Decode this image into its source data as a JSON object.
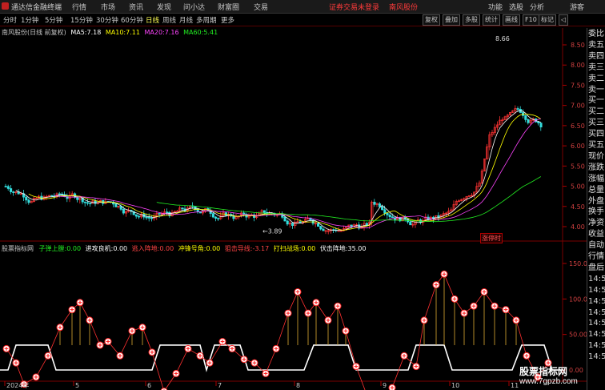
{
  "app": {
    "title": "通达信金融终端",
    "alert": "证券交易未登录",
    "stock_tab": "南风股份"
  },
  "menu": [
    "行情",
    "市场",
    "资讯",
    "发现",
    "问小达",
    "财富圈",
    "交易"
  ],
  "right_menu": [
    "功能",
    "选股",
    "分析",
    "游客"
  ],
  "periods": [
    "分时",
    "1分钟",
    "5分钟",
    "15分钟",
    "30分钟",
    "60分钟",
    "日线",
    "周线",
    "月线",
    "多周期",
    "更多"
  ],
  "active_period": "日线",
  "toolbar_buttons": [
    "复权",
    "叠加",
    "多股",
    "统计",
    "画线",
    "F10",
    "标记",
    "◁"
  ],
  "main_chart": {
    "title": "南风股份(日线 前复权)",
    "ma": [
      {
        "label": "MA5:",
        "value": "7.18",
        "color": "#ffffff"
      },
      {
        "label": "MA10:",
        "value": "7.11",
        "color": "#ffff00"
      },
      {
        "label": "MA20:",
        "value": "7.16",
        "color": "#ff44ff"
      },
      {
        "label": "MA60:",
        "value": "5.41",
        "color": "#22ee22"
      }
    ],
    "high_label": "8.66",
    "low_label": "3.89",
    "y_ticks": [
      "8.50",
      "8.00",
      "7.50",
      "7.00",
      "6.50",
      "6.00",
      "5.50",
      "5.00",
      "4.50",
      "4.00"
    ],
    "tag": "涨停时"
  },
  "indicator": {
    "title": "股票指标网",
    "items": [
      {
        "label": "子弹上膛:",
        "value": "0.00",
        "color": "#22ee22"
      },
      {
        "label": "进攻良机:",
        "value": "0.00",
        "color": "#ffffff"
      },
      {
        "label": "逃入阵地:",
        "value": "0.00",
        "color": "#ff4444"
      },
      {
        "label": "冲锋号角:",
        "value": "0.00",
        "color": "#ffff00"
      },
      {
        "label": "狙击导线:",
        "value": "-3.17",
        "color": "#ff4444"
      },
      {
        "label": "打扫战场:",
        "value": "0.00",
        "color": "#ffff00"
      },
      {
        "label": "伏击阵地:",
        "value": "35.00",
        "color": "#ffffff"
      }
    ],
    "y_ticks": [
      "150.00",
      "100.00",
      "50.00",
      "0.00"
    ]
  },
  "right_panel": [
    "委比",
    "卖五",
    "卖四",
    "卖三",
    "卖二",
    "卖一",
    "买一",
    "买二",
    "买三",
    "买四",
    "买五",
    "现价",
    "涨跌",
    "涨幅",
    "总量",
    "外盘",
    "换手",
    "净资",
    "收益",
    "自动",
    "行情",
    "盘后",
    "14:5",
    "14:5",
    "14:5",
    "14:5",
    "14:5",
    "14:5",
    "14:5",
    "14:5"
  ],
  "dates": [
    "2024年",
    "5",
    "6",
    "7",
    "8",
    "9",
    "10",
    "11"
  ],
  "watermark": {
    "line1": "股票指标网",
    "line2": "www.7gpzb.com"
  }
}
